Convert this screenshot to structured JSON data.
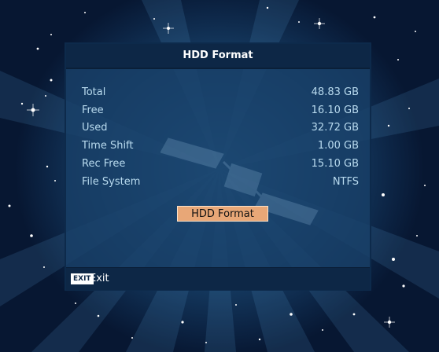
{
  "dialog": {
    "title": "HDD Format",
    "rows": [
      {
        "label": "Total",
        "value": "48.83 GB"
      },
      {
        "label": "Free",
        "value": "16.10 GB"
      },
      {
        "label": "Used",
        "value": "32.72 GB"
      },
      {
        "label": "Time Shift",
        "value": "1.00 GB"
      },
      {
        "label": "Rec Free",
        "value": "15.10 GB"
      },
      {
        "label": "File System",
        "value": "NTFS"
      }
    ],
    "format_button_label": "HDD Format"
  },
  "footer": {
    "exit_key": "EXIT",
    "exit_label": "Exit"
  },
  "colors": {
    "background": "#1e4f7c",
    "panel": "#184068",
    "title_bar": "#0d2746",
    "selected_button": "#e8a777",
    "text": "#b9dbef"
  }
}
